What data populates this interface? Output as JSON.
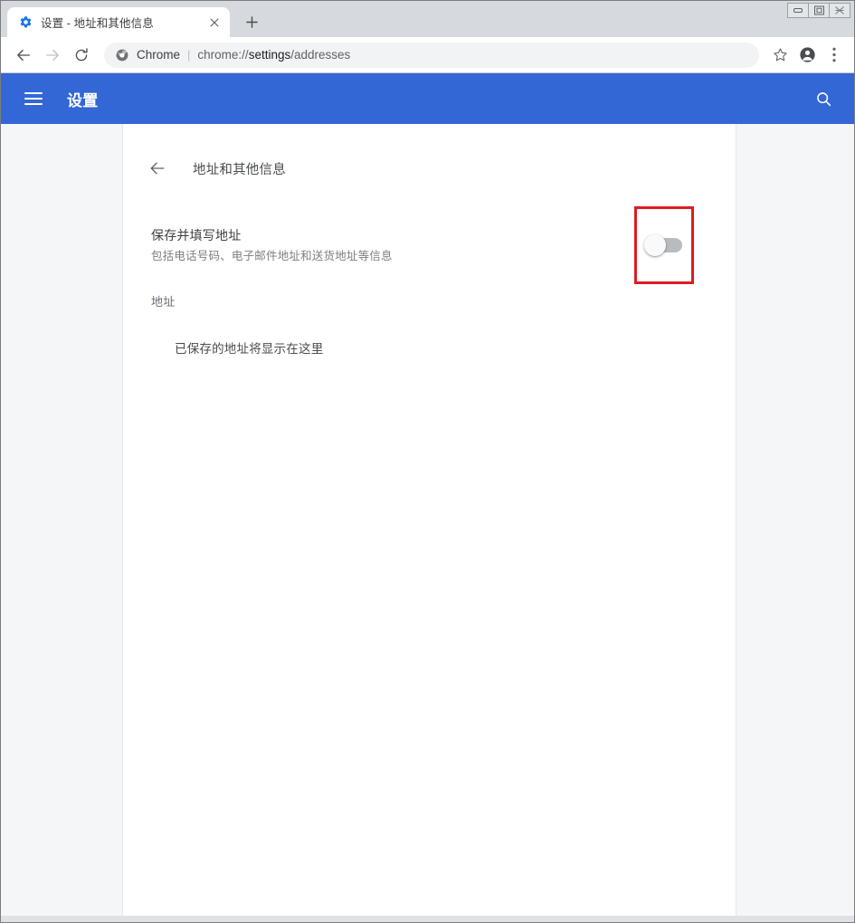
{
  "window": {
    "controls": [
      {
        "name": "minimize",
        "icon": "minimize-icon"
      },
      {
        "name": "restore",
        "icon": "restore-icon"
      },
      {
        "name": "close",
        "icon": "close-icon"
      }
    ]
  },
  "tabstrip": {
    "tabs": [
      {
        "favicon": "settings-gear-icon",
        "title": "设置 - 地址和其他信息",
        "close_label": "✕"
      }
    ],
    "new_tab_label": "+"
  },
  "toolbar": {
    "back_icon": "back-arrow-icon",
    "forward_icon": "forward-arrow-icon",
    "reload_icon": "reload-icon",
    "omnibox": {
      "site_icon": "chrome-logo-icon",
      "scheme_label": "Chrome",
      "separator": "|",
      "url_prefix": "chrome://",
      "url_strong": "settings",
      "url_suffix": "/addresses",
      "url_full": "chrome://settings/addresses"
    },
    "bookmark_icon": "star-icon",
    "profile_icon": "account-avatar-icon",
    "menu_icon": "three-dot-menu-icon"
  },
  "settings_header": {
    "menu_icon": "hamburger-menu-icon",
    "title": "设置",
    "search_icon": "search-icon"
  },
  "subpage": {
    "back_icon": "back-arrow-icon",
    "title": "地址和其他信息"
  },
  "autofill_toggle": {
    "label": "保存并填写地址",
    "sublabel": "包括电话号码、电子邮件地址和送货地址等信息",
    "state": "off",
    "highlighted": true
  },
  "addresses_section": {
    "title": "地址",
    "empty_state": "已保存的地址将显示在这里"
  },
  "colors": {
    "header_blue": "#3367d6",
    "highlight_red": "#e01b22",
    "page_background": "#f5f6f7",
    "card_background": "#ffffff",
    "toggle_track_off": "#b9bcbf"
  }
}
